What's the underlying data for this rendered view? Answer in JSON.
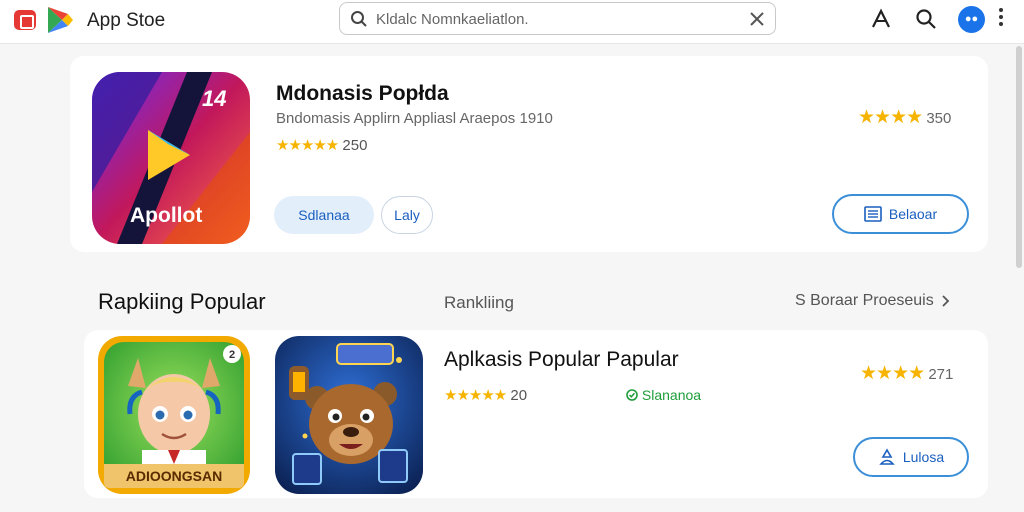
{
  "header": {
    "title": "App Stoe",
    "search": {
      "value": "Kldalc Nomnkaeliatlon."
    },
    "icons": [
      "store-logo-icon",
      "play-logo-icon",
      "search-icon",
      "close-icon",
      "font-icon",
      "search-icon",
      "avatar",
      "more-vert-icon"
    ]
  },
  "featured": {
    "badge": "14",
    "icon_text": "Apollot",
    "title": "Mdonasis Popłda",
    "subtitle": "Bndomasis Applirn Appliasl Araepos 1910",
    "stars": "★★★★★",
    "rating": "250",
    "rating_right_stars": "★★★★",
    "rating_right": "350",
    "pill_primary": "Sdlanaa",
    "pill_secondary": "Laly",
    "action_label": "Belaoar"
  },
  "section": {
    "title": "Rapkiing Popular",
    "mid_label": "Rankliing",
    "see_more": "S Boraar Proeseuis"
  },
  "list_item": {
    "icon_a_label": "ADIOONGSAN",
    "icon_a_badge": "2",
    "title": "Aplkasis Popular Papular",
    "stars": "★★★★★",
    "rating": "20",
    "status": "Slananoa",
    "rating_right_stars": "★★★★",
    "rating_right": "271",
    "action_label": "Lulosa"
  },
  "colors": {
    "accent": "#1a73e8",
    "star": "#f6b400",
    "status_green": "#1f9d3a",
    "button_border": "#3a8fd8"
  }
}
